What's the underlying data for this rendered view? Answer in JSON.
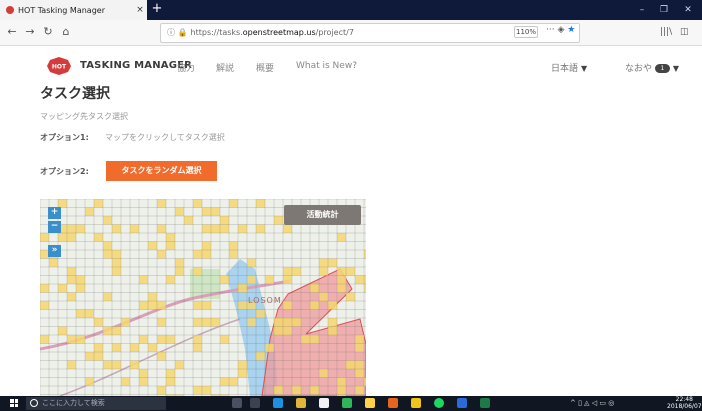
{
  "browser": {
    "tab_title": "HOT Tasking Manager",
    "tab_close": "×",
    "new_tab": "+",
    "url_prefix": "https://tasks.",
    "url_domain": "openstreetmap.us",
    "url_path": "/project/7",
    "zoom": "110%",
    "page_actions": "···"
  },
  "header": {
    "brand": "TASKING MANAGER",
    "logo_text": "HOT",
    "menu": [
      "協力",
      "解説",
      "概要",
      "What is New?"
    ],
    "language": "日本語",
    "user": "なおや",
    "notifications": "1"
  },
  "content": {
    "title": "タスク選択",
    "subtitle": "マッピング先タスク選択",
    "option1_label": "オプション1:",
    "option1_text": "マップをクリックしてタスク選択",
    "option2_label": "オプション2:",
    "random_button": "タスクをランダム選択"
  },
  "map": {
    "zoom_in": "+",
    "zoom_out": "−",
    "expand": "»",
    "stats_button": "活動統計",
    "place_label": "LOSOM"
  },
  "taskbar": {
    "search_placeholder": "ここに入力して検索",
    "time": "22:48",
    "date": "2018/06/07"
  },
  "colors": {
    "accent": "#f06b2c",
    "task_highlight": "#f5d770",
    "area_fill": "#ef9a9a",
    "zoom_control": "#3a8ec9"
  }
}
